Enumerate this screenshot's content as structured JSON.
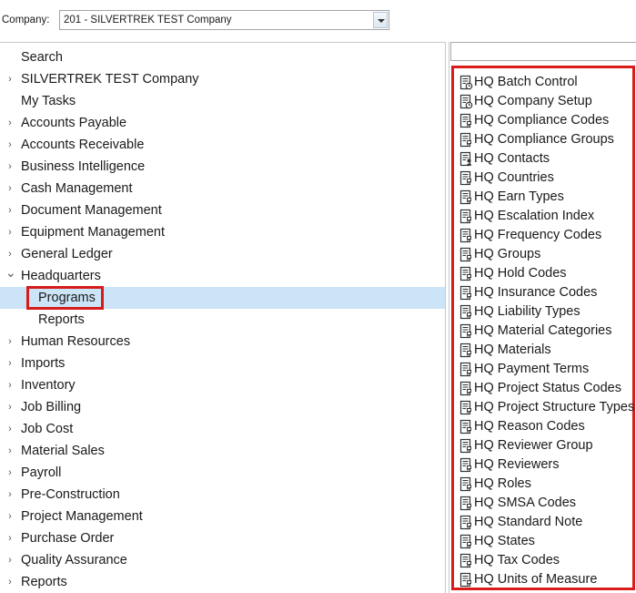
{
  "company": {
    "label": "Company:",
    "value": "201 - SILVERTREK TEST Company"
  },
  "tree": {
    "items": [
      {
        "label": "Search",
        "chevron": ""
      },
      {
        "label": "SILVERTREK TEST Company",
        "chevron": "›"
      },
      {
        "label": "My Tasks",
        "chevron": ""
      },
      {
        "label": "Accounts Payable",
        "chevron": "›"
      },
      {
        "label": "Accounts Receivable",
        "chevron": "›"
      },
      {
        "label": "Business Intelligence",
        "chevron": "›"
      },
      {
        "label": "Cash Management",
        "chevron": "›"
      },
      {
        "label": "Document Management",
        "chevron": "›"
      },
      {
        "label": "Equipment Management",
        "chevron": "›"
      },
      {
        "label": "General Ledger",
        "chevron": "›"
      },
      {
        "label": "Headquarters",
        "chevron": "⌄"
      },
      {
        "label": "Programs",
        "chevron": ""
      },
      {
        "label": "Reports",
        "chevron": ""
      },
      {
        "label": "Human Resources",
        "chevron": "›"
      },
      {
        "label": "Imports",
        "chevron": "›"
      },
      {
        "label": "Inventory",
        "chevron": "›"
      },
      {
        "label": "Job Billing",
        "chevron": "›"
      },
      {
        "label": "Job Cost",
        "chevron": "›"
      },
      {
        "label": "Material Sales",
        "chevron": "›"
      },
      {
        "label": "Payroll",
        "chevron": "›"
      },
      {
        "label": "Pre-Construction",
        "chevron": "›"
      },
      {
        "label": "Project Management",
        "chevron": "›"
      },
      {
        "label": "Purchase Order",
        "chevron": "›"
      },
      {
        "label": "Quality Assurance",
        "chevron": "›"
      },
      {
        "label": "Reports",
        "chevron": "›"
      }
    ]
  },
  "programs": {
    "items": [
      {
        "label": "HQ Batch Control",
        "icon": "batch-form-icon"
      },
      {
        "label": "HQ Company Setup",
        "icon": "setup-form-icon"
      },
      {
        "label": "HQ Compliance Codes",
        "icon": "form-icon"
      },
      {
        "label": "HQ Compliance Groups",
        "icon": "form-icon"
      },
      {
        "label": "HQ Contacts",
        "icon": "contact-form-icon"
      },
      {
        "label": "HQ Countries",
        "icon": "form-icon"
      },
      {
        "label": "HQ Earn Types",
        "icon": "form-icon"
      },
      {
        "label": "HQ Escalation Index",
        "icon": "form-icon"
      },
      {
        "label": "HQ Frequency Codes",
        "icon": "form-icon"
      },
      {
        "label": "HQ Groups",
        "icon": "form-icon"
      },
      {
        "label": "HQ Hold Codes",
        "icon": "form-icon"
      },
      {
        "label": "HQ Insurance Codes",
        "icon": "form-icon"
      },
      {
        "label": "HQ Liability Types",
        "icon": "form-icon"
      },
      {
        "label": "HQ Material Categories",
        "icon": "form-icon"
      },
      {
        "label": "HQ Materials",
        "icon": "form-icon"
      },
      {
        "label": "HQ Payment Terms",
        "icon": "form-icon"
      },
      {
        "label": "HQ Project Status Codes",
        "icon": "form-icon"
      },
      {
        "label": "HQ Project Structure Types",
        "icon": "form-icon"
      },
      {
        "label": "HQ Reason Codes",
        "icon": "form-icon"
      },
      {
        "label": "HQ Reviewer Group",
        "icon": "form-icon"
      },
      {
        "label": "HQ Reviewers",
        "icon": "form-icon"
      },
      {
        "label": "HQ Roles",
        "icon": "form-icon"
      },
      {
        "label": "HQ SMSA Codes",
        "icon": "form-icon"
      },
      {
        "label": "HQ Standard Note",
        "icon": "form-icon"
      },
      {
        "label": "HQ States",
        "icon": "form-icon"
      },
      {
        "label": "HQ Tax Codes",
        "icon": "form-icon"
      },
      {
        "label": "HQ Units of Measure",
        "icon": "form-icon"
      }
    ]
  },
  "colors": {
    "selection": "#cce4f7",
    "highlight_border": "#d81b1b"
  }
}
